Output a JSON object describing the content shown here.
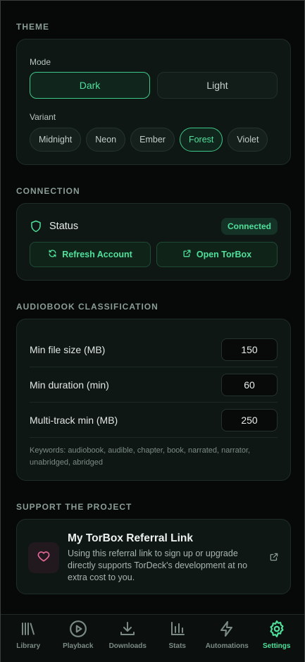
{
  "theme": {
    "section_title": "THEME",
    "mode_label": "Mode",
    "modes": [
      {
        "label": "Dark",
        "active": true
      },
      {
        "label": "Light",
        "active": false
      }
    ],
    "variant_label": "Variant",
    "variants": [
      {
        "label": "Midnight",
        "active": false
      },
      {
        "label": "Neon",
        "active": false
      },
      {
        "label": "Ember",
        "active": false
      },
      {
        "label": "Forest",
        "active": true
      },
      {
        "label": "Violet",
        "active": false
      }
    ]
  },
  "connection": {
    "section_title": "CONNECTION",
    "status_label": "Status",
    "status_badge": "Connected",
    "refresh_label": "Refresh Account",
    "open_label": "Open TorBox"
  },
  "audiobook": {
    "section_title": "AUDIOBOOK CLASSIFICATION",
    "fields": [
      {
        "label": "Min file size (MB)",
        "value": "150"
      },
      {
        "label": "Min duration (min)",
        "value": "60"
      },
      {
        "label": "Multi-track min (MB)",
        "value": "250"
      }
    ],
    "keywords": "Keywords: audiobook, audible, chapter, book, narrated, narrator, unabridged, abridged"
  },
  "support": {
    "section_title": "SUPPORT THE PROJECT",
    "title": "My TorBox Referral Link",
    "description": "Using this referral link to sign up or upgrade directly supports TorDeck's development at no extra cost to you."
  },
  "nav": {
    "items": [
      {
        "label": "Library",
        "icon": "library-icon",
        "active": false
      },
      {
        "label": "Playback",
        "icon": "play-circle-icon",
        "active": false
      },
      {
        "label": "Downloads",
        "icon": "download-icon",
        "active": false
      },
      {
        "label": "Stats",
        "icon": "bar-chart-icon",
        "active": false
      },
      {
        "label": "Automations",
        "icon": "lightning-icon",
        "active": false
      },
      {
        "label": "Settings",
        "icon": "gear-icon",
        "active": true
      }
    ]
  },
  "colors": {
    "accent": "#4fe09b",
    "background": "#060908",
    "card": "#0f1714",
    "heart": "#e86a9a"
  }
}
